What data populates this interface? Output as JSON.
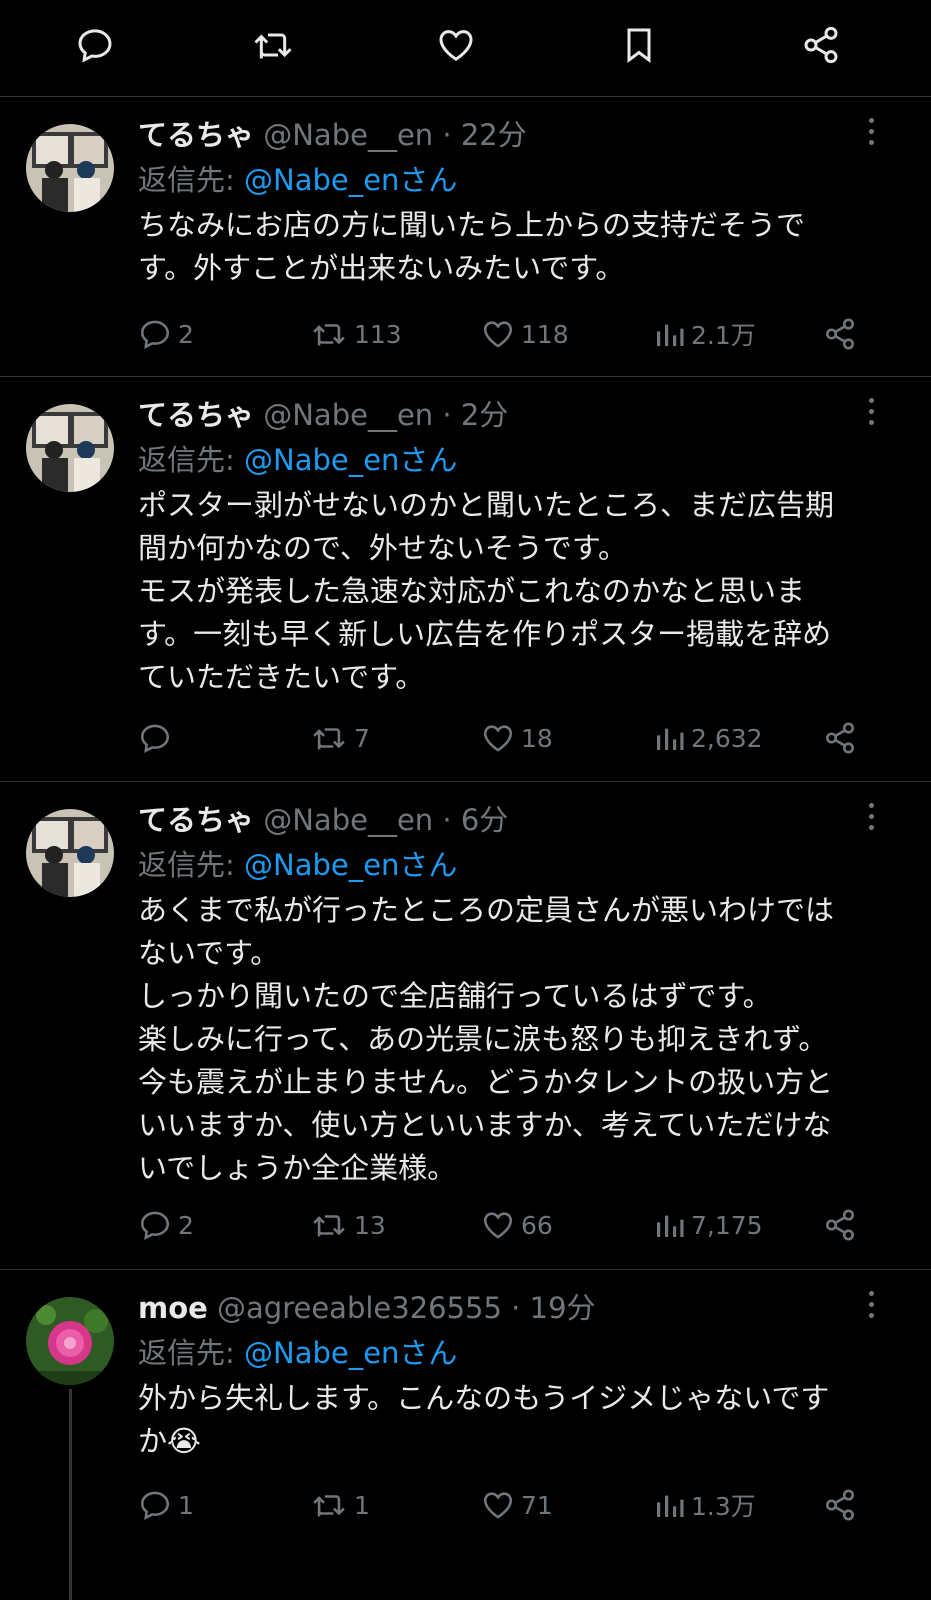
{
  "tweets": [
    {
      "name": "てるちゃ",
      "handle": "@Nabe__en",
      "time": "22分",
      "reply_label": "返信先:",
      "reply_to": "@Nabe_enさん",
      "text": "ちなみにお店の方に聞いたら上からの支持だそうで\nす。外すことが出来ないみたいです。",
      "replies": "2",
      "retweets": "113",
      "likes": "118",
      "views": "2.1万"
    },
    {
      "name": "てるちゃ",
      "handle": "@Nabe__en",
      "time": "2分",
      "reply_label": "返信先:",
      "reply_to": "@Nabe_enさん",
      "text": "ポスター剥がせないのかと聞いたところ、まだ広告期\n間か何かなので、外せないそうです。\nモスが発表した急速な対応がこれなのかなと思いま\nす。一刻も早く新しい広告を作りポスター掲載を辞め\nていただきたいです。",
      "replies": "",
      "retweets": "7",
      "likes": "18",
      "views": "2,632"
    },
    {
      "name": "てるちゃ",
      "handle": "@Nabe__en",
      "time": "6分",
      "reply_label": "返信先:",
      "reply_to": "@Nabe_enさん",
      "text": "あくまで私が行ったところの定員さんが悪いわけでは\nないです。\nしっかり聞いたので全店舗行っているはずです。\n楽しみに行って、あの光景に涙も怒りも抑えきれず。\n今も震えが止まりません。どうかタレントの扱い方と\nいいますか、使い方といいますか、考えていただけな\nいでしょうか全企業様。",
      "replies": "2",
      "retweets": "13",
      "likes": "66",
      "views": "7,175"
    },
    {
      "name": "moe",
      "handle": "@agreeable326555",
      "time": "19分",
      "reply_label": "返信先:",
      "reply_to": "@Nabe_enさん",
      "text": "外から失礼します。こんなのもうイジメじゃないです\nか😭",
      "replies": "1",
      "retweets": "1",
      "likes": "71",
      "views": "1.3万"
    }
  ],
  "icons": {
    "top": [
      "reply-icon",
      "retweet-icon",
      "like-icon",
      "bookmark-icon",
      "share-icon"
    ],
    "row": [
      "reply-icon",
      "retweet-icon",
      "like-icon",
      "views-icon",
      "share-icon"
    ]
  },
  "colors": {
    "background": "#000000",
    "text": "#e7e9ea",
    "muted": "#71767b",
    "link": "#1d9bf0",
    "divider": "#2f3336"
  }
}
